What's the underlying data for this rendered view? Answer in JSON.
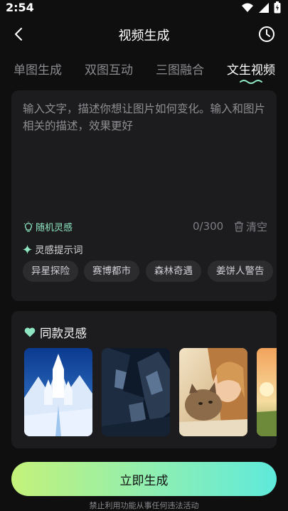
{
  "status": {
    "time": "2:54"
  },
  "header": {
    "title": "视频生成"
  },
  "tabs": [
    {
      "label": "单图生成",
      "active": false
    },
    {
      "label": "双图互动",
      "active": false
    },
    {
      "label": "三图融合",
      "active": false
    },
    {
      "label": "文生视频",
      "active": true
    }
  ],
  "input": {
    "placeholder": "输入文字，描述你想让图片如何变化。输入和图片相关的描述，效果更好",
    "random_label": "随机灵感",
    "counter": "0/300",
    "clear_label": "清空",
    "hint_title": "灵感提示词",
    "chips": [
      "异星探险",
      "赛博都市",
      "森林奇遇",
      "姜饼人警告"
    ]
  },
  "inspiration": {
    "title": "同款灵感",
    "thumbnails": [
      "ice-castle",
      "cyber-robot",
      "girl-with-cat",
      "sunset-field"
    ]
  },
  "footer": {
    "generate_label": "立即生成",
    "disclaimer": "禁止利用功能从事任何违法活动"
  },
  "colors": {
    "accent_green": "#8ee6c2",
    "button_gradient_start": "#c4f27a",
    "button_gradient_end": "#5eeadb",
    "panel_bg": "#1c1c1e",
    "page_bg": "#0f0f10"
  }
}
